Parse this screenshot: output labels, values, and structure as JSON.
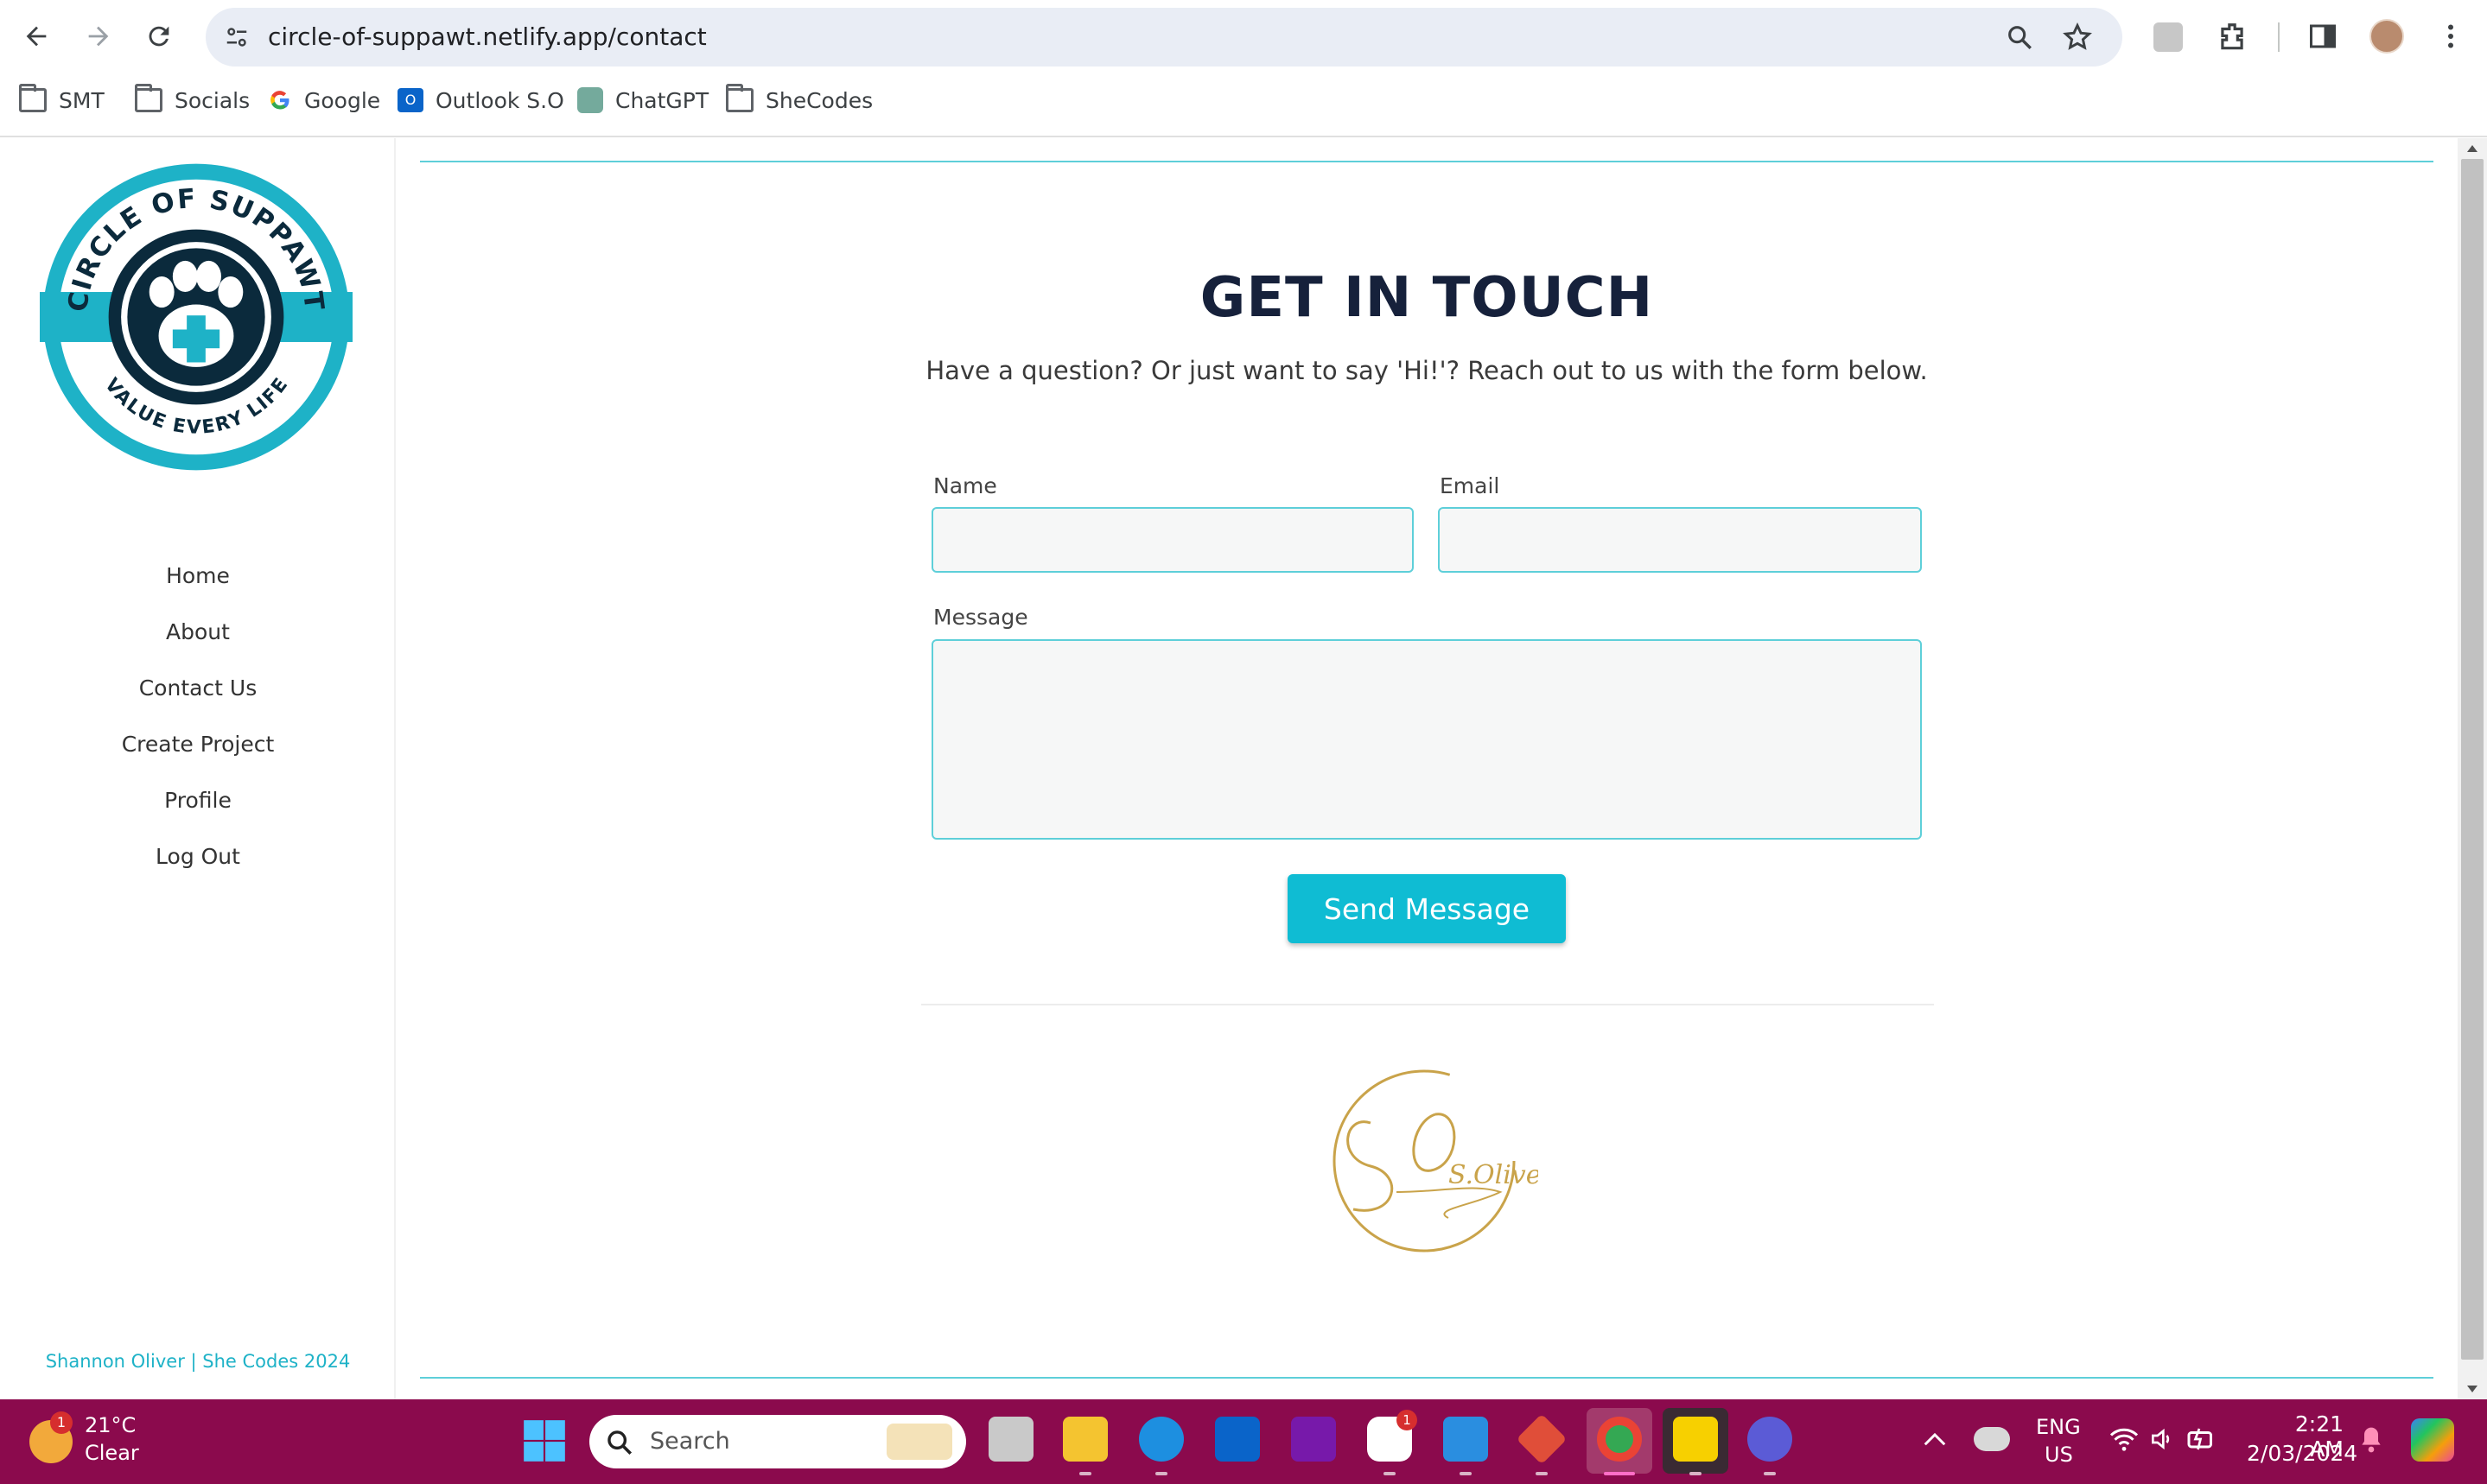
{
  "browser": {
    "url": "circle-of-suppawt.netlify.app/contact",
    "bookmarks": [
      {
        "label": "SMT",
        "icon": "folder-icon"
      },
      {
        "label": "Socials",
        "icon": "folder-icon"
      },
      {
        "label": "Google",
        "icon": "google-icon"
      },
      {
        "label": "Outlook S.O",
        "icon": "outlook-icon"
      },
      {
        "label": "ChatGPT",
        "icon": "chatgpt-icon"
      },
      {
        "label": "SheCodes",
        "icon": "folder-icon"
      }
    ]
  },
  "sidebar": {
    "logo": {
      "top_text": "CIRCLE OF SUPPAWT",
      "bottom_text": "VALUE EVERY LIFE"
    },
    "nav": [
      "Home",
      "About",
      "Contact Us",
      "Create Project",
      "Profile",
      "Log Out"
    ],
    "credit": "Shannon Oliver | She Codes 2024"
  },
  "contact": {
    "title": "GET IN TOUCH",
    "subtitle": "Have a question? Or just want to say 'Hi!'? Reach out to us with the form below.",
    "name_label": "Name",
    "email_label": "Email",
    "message_label": "Message",
    "name_value": "",
    "email_value": "",
    "message_value": "",
    "send_label": "Send Message",
    "signature": "S.Oliver"
  },
  "taskbar": {
    "weather_temp": "21°C",
    "weather_desc": "Clear",
    "weather_badge": "1",
    "search_placeholder": "Search",
    "slack_badge": "1",
    "lang_top": "ENG",
    "lang_bottom": "US",
    "time": "2:21 AM",
    "date": "2/03/2024"
  },
  "colors": {
    "accent": "#0fbcd3",
    "heading": "#16213b",
    "taskbar": "#8b0a4d",
    "logo_ring": "#1eb2c7",
    "logo_dark": "#0b2a3c",
    "signature_gold": "#c9a34a"
  }
}
